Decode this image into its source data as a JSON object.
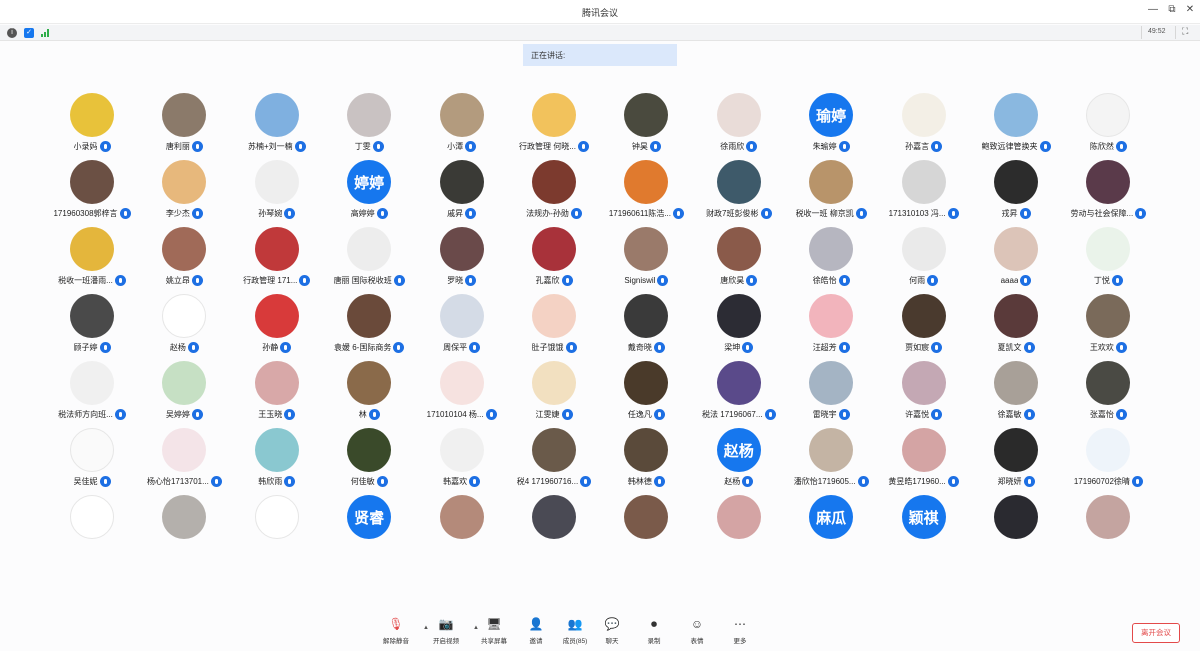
{
  "window": {
    "title": "腾讯会议",
    "minimize": "—",
    "maximize": "⧉",
    "close": "✕"
  },
  "infobar": {
    "info_icon": "i",
    "shield_icon": "✓",
    "meeting_id": "49:52"
  },
  "speaking": {
    "label": "正在讲话:"
  },
  "colors": {
    "accent": "#1677ee",
    "danger": "#e34a4a"
  },
  "participants": [
    {
      "name": "小录妈",
      "avatar": "#e8c23a"
    },
    {
      "name": "唐利丽",
      "avatar": "#8b7a6a"
    },
    {
      "name": "苏楠+刘一楠",
      "avatar": "#7fb0e0"
    },
    {
      "name": "丁雯",
      "avatar": "#c9c2c2"
    },
    {
      "name": "小潭",
      "avatar": "#b39b7e"
    },
    {
      "name": "行政管理 何晓...",
      "avatar": "#f2c25c"
    },
    {
      "name": "钟昊",
      "avatar": "#4a4a3e"
    },
    {
      "name": "徐雨欣",
      "avatar": "#e9dcd8"
    },
    {
      "name": "朱瑜婷",
      "avatar_text": "瑜婷"
    },
    {
      "name": "孙嘉言",
      "avatar": "#f3efe6"
    },
    {
      "name": "鲍致远律管换夹",
      "avatar": "#8ab8e0"
    },
    {
      "name": "陈欣然",
      "avatar": "#f4f4f4"
    },
    {
      "name": "171960308郭梓言",
      "avatar": "#6b5044"
    },
    {
      "name": "李少杰",
      "avatar": "#e7b87c"
    },
    {
      "name": "孙琴婉",
      "avatar": "#eeeeee"
    },
    {
      "name": "高婷婷",
      "avatar_text": "婷婷"
    },
    {
      "name": "戚昇",
      "avatar": "#3a3a36"
    },
    {
      "name": "法规办-孙勋",
      "avatar": "#7c3a2e"
    },
    {
      "name": "171960611陈浩...",
      "avatar": "#e07a2e"
    },
    {
      "name": "财政7班彭俊彬",
      "avatar": "#3e5a6a"
    },
    {
      "name": "税收一班 柳京凯",
      "avatar": "#b8946a"
    },
    {
      "name": "171310103 冯...",
      "avatar": "#d6d6d6"
    },
    {
      "name": "戎昇",
      "avatar": "#2c2c2c"
    },
    {
      "name": "劳动与社会保障...",
      "avatar": "#5a3a4a"
    },
    {
      "name": "税收一班潘雨...",
      "avatar": "#e4b63c"
    },
    {
      "name": "姚立昂",
      "avatar": "#a06a58"
    },
    {
      "name": "行政管理 171...",
      "avatar": "#c0393a"
    },
    {
      "name": "唐丽 国际税收班",
      "avatar": "#ededed"
    },
    {
      "name": "罗晓",
      "avatar": "#6a4a4a"
    },
    {
      "name": "孔嘉欣",
      "avatar": "#a8323a"
    },
    {
      "name": "Signiswil",
      "avatar": "#9a7a6a"
    },
    {
      "name": "唐欣昊",
      "avatar": "#8a5a4a"
    },
    {
      "name": "徐皓怡",
      "avatar": "#b6b6c0"
    },
    {
      "name": "何雨",
      "avatar": "#eaeaea"
    },
    {
      "name": "aaaa",
      "avatar": "#dcc4b8"
    },
    {
      "name": "丁悦",
      "avatar": "#eaf3ea"
    },
    {
      "name": "顾子婷",
      "avatar": "#4a4a4a"
    },
    {
      "name": "赵杨",
      "avatar": "#ffffff"
    },
    {
      "name": "孙静",
      "avatar": "#d83a3a"
    },
    {
      "name": "袁媛 6-国际商务",
      "avatar": "#6a4a3a"
    },
    {
      "name": "周保平",
      "avatar": "#d4dbe6"
    },
    {
      "name": "肚子饿饿",
      "avatar": "#f4d2c4"
    },
    {
      "name": "戴奇晓",
      "avatar": "#3a3a3a"
    },
    {
      "name": "梁坤",
      "avatar": "#2c2c34"
    },
    {
      "name": "汪超芳",
      "avatar": "#f2b4bc"
    },
    {
      "name": "贾如宸",
      "avatar": "#4a3a2e"
    },
    {
      "name": "夏凯文",
      "avatar": "#5a3a3a"
    },
    {
      "name": "王欢欢",
      "avatar": "#7a6a5a"
    },
    {
      "name": "税法师方向班...",
      "avatar": "#f0f0f0"
    },
    {
      "name": "吴婷婷",
      "avatar": "#c6e0c4"
    },
    {
      "name": "王玉晓",
      "avatar": "#d8a8a8"
    },
    {
      "name": "林",
      "avatar": "#8a6a4a"
    },
    {
      "name": "171010104 杨...",
      "avatar": "#f6e2e0"
    },
    {
      "name": "江雯婕",
      "avatar": "#f2e0c0"
    },
    {
      "name": "任逸凡",
      "avatar": "#4a3a2a"
    },
    {
      "name": "税法 17196067...",
      "avatar": "#5a4a8a"
    },
    {
      "name": "雷晓宇",
      "avatar": "#a4b4c4"
    },
    {
      "name": "许嘉悦",
      "avatar": "#c4a8b4"
    },
    {
      "name": "徐嘉敏",
      "avatar": "#a8a098"
    },
    {
      "name": "张嘉怡",
      "avatar": "#4a4a44"
    },
    {
      "name": "吴佳妮",
      "avatar": "#fafafa"
    },
    {
      "name": "杨心怡1713701...",
      "avatar": "#f4e4e8"
    },
    {
      "name": "韩欣雨",
      "avatar": "#8ac8d0"
    },
    {
      "name": "何佳敏",
      "avatar": "#3a4a2a"
    },
    {
      "name": "韩嘉欢",
      "avatar": "#f0f0f0"
    },
    {
      "name": "税4 171960716...",
      "avatar": "#6a5a4a"
    },
    {
      "name": "韩林德",
      "avatar": "#5a4a3a"
    },
    {
      "name": "赵杨",
      "avatar_text": "赵杨"
    },
    {
      "name": "潘欣怡1719605...",
      "avatar": "#c4b4a4"
    },
    {
      "name": "黄昱皓171960...",
      "avatar": "#d4a4a4"
    },
    {
      "name": "郑晓妍",
      "avatar": "#2a2a2a"
    },
    {
      "name": "171960702徐晴",
      "avatar": "#eef4fa"
    },
    {
      "name": "",
      "avatar": "#ffffff"
    },
    {
      "name": "",
      "avatar": "#b4b0ac"
    },
    {
      "name": "",
      "avatar": "#ffffff"
    },
    {
      "name": "",
      "avatar_text": "贤睿"
    },
    {
      "name": "",
      "avatar": "#b48a7a"
    },
    {
      "name": "",
      "avatar": "#4a4a54"
    },
    {
      "name": "",
      "avatar": "#7a5a4a"
    },
    {
      "name": "",
      "avatar": "#d4a4a4"
    },
    {
      "name": "",
      "avatar_text": "麻瓜"
    },
    {
      "name": "",
      "avatar_text": "颖祺"
    },
    {
      "name": "",
      "avatar": "#2a2a30"
    },
    {
      "name": "",
      "avatar": "#c4a4a0"
    }
  ],
  "toolbar": [
    {
      "label": "解除静音",
      "icon": "🎙"
    },
    {
      "label": "开启视频",
      "icon": "📷"
    },
    {
      "label": "共享屏幕",
      "icon": "🖥"
    },
    {
      "label": "邀请",
      "icon": "👤"
    },
    {
      "label": "成员(85)",
      "icon": "👥"
    },
    {
      "label": "聊天",
      "icon": "💬"
    },
    {
      "label": "录制",
      "icon": "⏺"
    },
    {
      "label": "表情",
      "icon": "☺"
    },
    {
      "label": "更多",
      "icon": "⋯"
    }
  ],
  "leave_label": "离开会议"
}
